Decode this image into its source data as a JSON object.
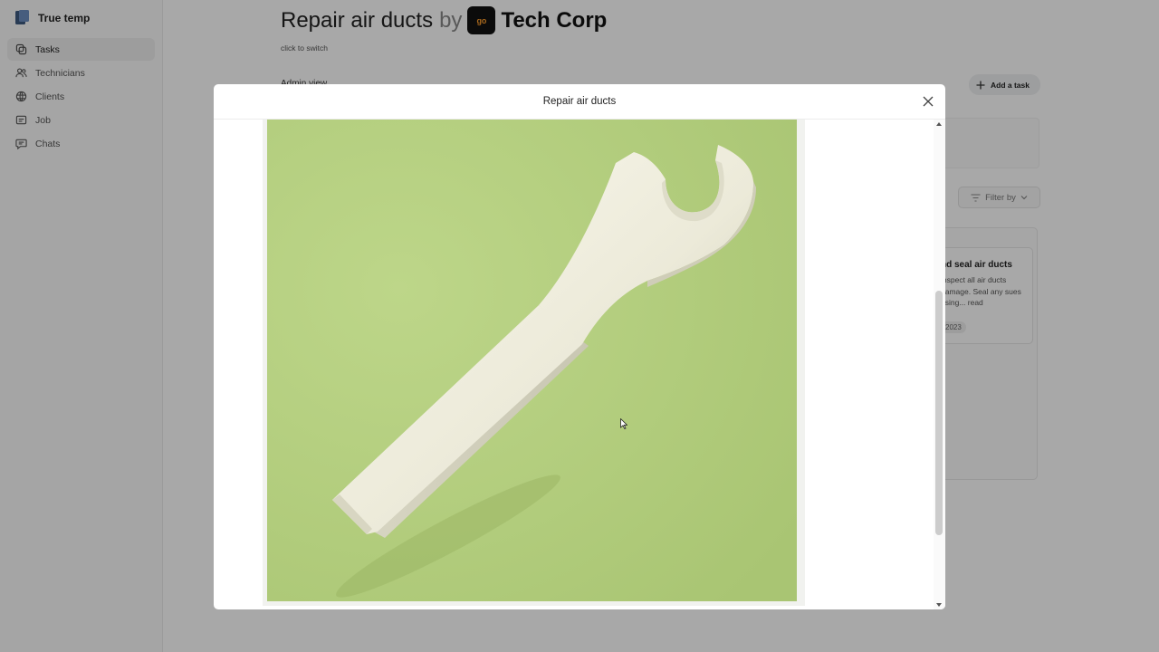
{
  "sidebar": {
    "brand": "True temp",
    "items": [
      {
        "label": "Tasks",
        "icon": "tasks-icon",
        "active": true
      },
      {
        "label": "Technicians",
        "icon": "users-icon"
      },
      {
        "label": "Clients",
        "icon": "clients-icon"
      },
      {
        "label": "Job",
        "icon": "job-icon"
      },
      {
        "label": "Chats",
        "icon": "chat-icon"
      }
    ]
  },
  "header": {
    "title": "Repair air ducts",
    "by": "by",
    "org_logo_text": "go",
    "org_name": "Tech Corp",
    "subtitle": "click to switch"
  },
  "toolbar": {
    "admin_view": "Admin view",
    "add_task_label": "Add a task",
    "filter_label": "Filter by"
  },
  "card": {
    "title": "nd seal air ducts",
    "description": "inspect all air ducts damage. Seal any sues using... read",
    "date": "2023"
  },
  "modal": {
    "title": "Repair air ducts",
    "image_subject": "wrench-image"
  },
  "colors": {
    "image_background": "#b5cf82",
    "overlay": "rgba(0,0,0,0.34)",
    "org_logo_accent": "#ff9e2c"
  }
}
